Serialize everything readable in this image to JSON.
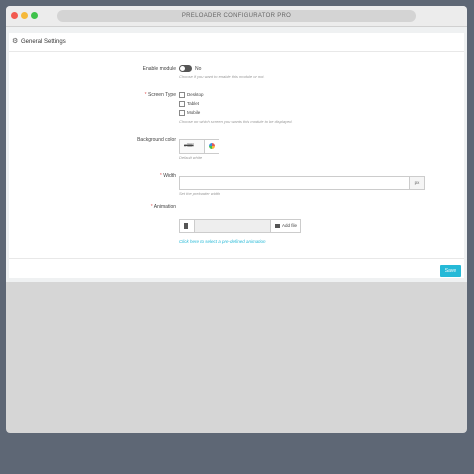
{
  "browser": {
    "url_bar_text": "PRELOADER CONFIGURATOR PRO"
  },
  "panel": {
    "gear_glyph": "⚙",
    "title": "General Settings"
  },
  "enable_module": {
    "label": "Enable module",
    "toggle_text": "No",
    "help": "Choose if you want to enable this module or not."
  },
  "screen_type": {
    "required_mark": "*",
    "label": "Screen Type",
    "options": [
      "Desktop",
      "Tablet",
      "Mobile"
    ],
    "help": "Choose on which screen you wants this module to be displayed."
  },
  "background_color": {
    "label": "Background color",
    "value": "#ffffff",
    "help": "Default white"
  },
  "width": {
    "required_mark": "*",
    "label": "Width",
    "value": "",
    "addon": "px",
    "help": "Set the preloader width"
  },
  "animation": {
    "required_mark": "*",
    "label": "Animation",
    "value": "",
    "add_file_label": "Add file",
    "link_text": "Click here to select a pre-defined animation"
  },
  "footer": {
    "save_label": "Save"
  },
  "colors": {
    "accent": "#25b9d7",
    "required": "#e25a5a"
  }
}
